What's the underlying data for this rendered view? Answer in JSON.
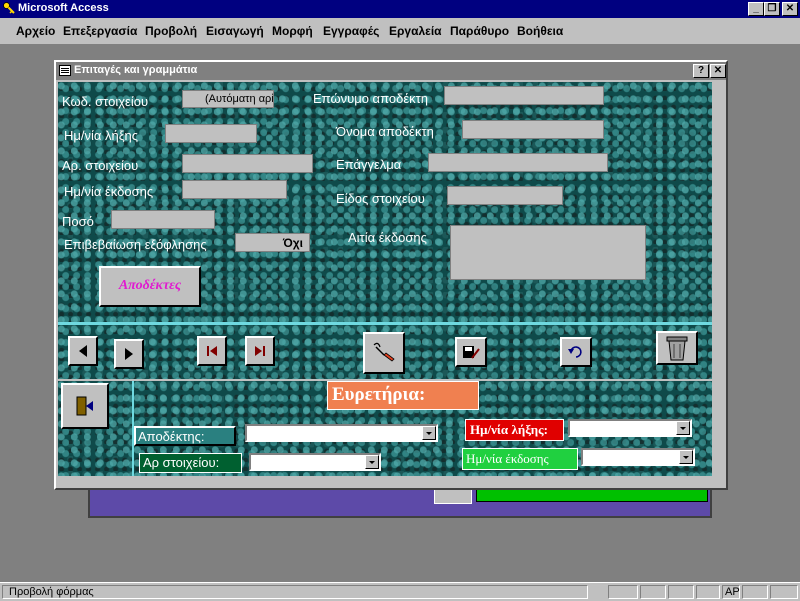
{
  "app": {
    "title": "Microsoft Access",
    "icon": "key-icon"
  },
  "window_controls": {
    "minimize": "_",
    "restore": "❐",
    "close": "✕"
  },
  "menu": [
    {
      "label": "Αρχείο"
    },
    {
      "label": "Επεξεργασία"
    },
    {
      "label": "Προβολή"
    },
    {
      "label": "Εισαγωγή"
    },
    {
      "label": "Μορφή"
    },
    {
      "label": "Εγγραφές"
    },
    {
      "label": "Εργαλεία"
    },
    {
      "label": "Παράθυρο"
    },
    {
      "label": "Βοήθεια"
    }
  ],
  "dialog": {
    "title": "Επιταγές και γραμμάτια",
    "help": "?",
    "close": "✕"
  },
  "form": {
    "code_label": "Κωδ. στοιχείου",
    "code_value": "(Αυτόματη αρί",
    "due_date_label": "Ημ/νία λήξης",
    "number_label": "Αρ. στοιχείου",
    "issue_date_label": "Ημ/νία έκδοσης",
    "amount_label": "Ποσό",
    "paid_label": "Επιβεβαίωση εξόφλησης",
    "paid_value": "Όχι",
    "surname_label": "Επώνυμο αποδέκτη",
    "name_label": "Όνομα αποδέκτη",
    "job_label": "Επάγγελμα",
    "type_label": "Είδος στοιχείου",
    "reason_label": "Αιτία έκδοσης",
    "recipients_button": "Αποδέκτες"
  },
  "indexes": {
    "title": "Ευρετήρια:",
    "recipient_label": "Αποδέκτης:",
    "number_label": "Αρ στοιχείου:",
    "due_date_label": "Ημ/νία λήξης:",
    "issue_date_label": "Ημ/νία έκδοσης"
  },
  "status": {
    "text": "Προβολή φόρμας",
    "mode": "ΑΡ"
  },
  "colors": {
    "title_bar": "#000080",
    "dialog_title_inactive": "#808080",
    "panel_teal": "#0f4a4a",
    "accent_line": "#6fd9e0",
    "recipients_text": "#e01ad0",
    "index_title_bg": "#f08050",
    "due_date_tag_bg": "#e00000",
    "issue_date_tag_bg": "#20d040",
    "recipient_tag_bg": "#2a8080",
    "number_tag_bg": "#006030"
  }
}
